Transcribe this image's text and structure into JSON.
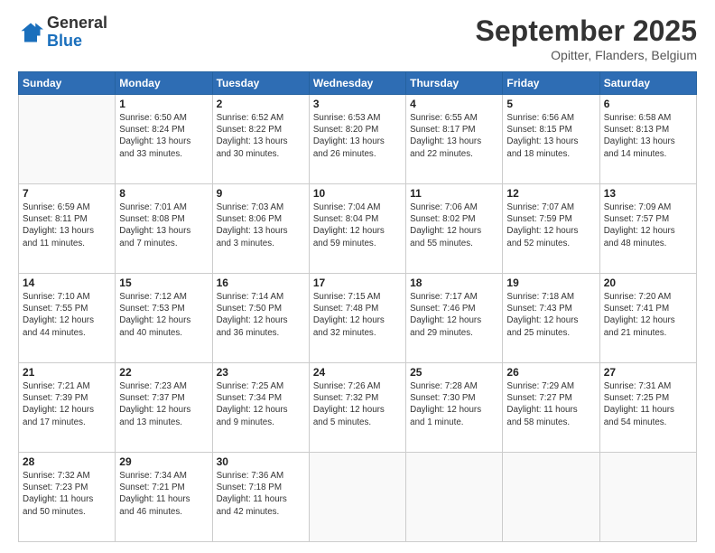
{
  "logo": {
    "general": "General",
    "blue": "Blue"
  },
  "title": "September 2025",
  "location": "Opitter, Flanders, Belgium",
  "days_header": [
    "Sunday",
    "Monday",
    "Tuesday",
    "Wednesday",
    "Thursday",
    "Friday",
    "Saturday"
  ],
  "weeks": [
    [
      {
        "day": "",
        "info": ""
      },
      {
        "day": "1",
        "info": "Sunrise: 6:50 AM\nSunset: 8:24 PM\nDaylight: 13 hours\nand 33 minutes."
      },
      {
        "day": "2",
        "info": "Sunrise: 6:52 AM\nSunset: 8:22 PM\nDaylight: 13 hours\nand 30 minutes."
      },
      {
        "day": "3",
        "info": "Sunrise: 6:53 AM\nSunset: 8:20 PM\nDaylight: 13 hours\nand 26 minutes."
      },
      {
        "day": "4",
        "info": "Sunrise: 6:55 AM\nSunset: 8:17 PM\nDaylight: 13 hours\nand 22 minutes."
      },
      {
        "day": "5",
        "info": "Sunrise: 6:56 AM\nSunset: 8:15 PM\nDaylight: 13 hours\nand 18 minutes."
      },
      {
        "day": "6",
        "info": "Sunrise: 6:58 AM\nSunset: 8:13 PM\nDaylight: 13 hours\nand 14 minutes."
      }
    ],
    [
      {
        "day": "7",
        "info": "Sunrise: 6:59 AM\nSunset: 8:11 PM\nDaylight: 13 hours\nand 11 minutes."
      },
      {
        "day": "8",
        "info": "Sunrise: 7:01 AM\nSunset: 8:08 PM\nDaylight: 13 hours\nand 7 minutes."
      },
      {
        "day": "9",
        "info": "Sunrise: 7:03 AM\nSunset: 8:06 PM\nDaylight: 13 hours\nand 3 minutes."
      },
      {
        "day": "10",
        "info": "Sunrise: 7:04 AM\nSunset: 8:04 PM\nDaylight: 12 hours\nand 59 minutes."
      },
      {
        "day": "11",
        "info": "Sunrise: 7:06 AM\nSunset: 8:02 PM\nDaylight: 12 hours\nand 55 minutes."
      },
      {
        "day": "12",
        "info": "Sunrise: 7:07 AM\nSunset: 7:59 PM\nDaylight: 12 hours\nand 52 minutes."
      },
      {
        "day": "13",
        "info": "Sunrise: 7:09 AM\nSunset: 7:57 PM\nDaylight: 12 hours\nand 48 minutes."
      }
    ],
    [
      {
        "day": "14",
        "info": "Sunrise: 7:10 AM\nSunset: 7:55 PM\nDaylight: 12 hours\nand 44 minutes."
      },
      {
        "day": "15",
        "info": "Sunrise: 7:12 AM\nSunset: 7:53 PM\nDaylight: 12 hours\nand 40 minutes."
      },
      {
        "day": "16",
        "info": "Sunrise: 7:14 AM\nSunset: 7:50 PM\nDaylight: 12 hours\nand 36 minutes."
      },
      {
        "day": "17",
        "info": "Sunrise: 7:15 AM\nSunset: 7:48 PM\nDaylight: 12 hours\nand 32 minutes."
      },
      {
        "day": "18",
        "info": "Sunrise: 7:17 AM\nSunset: 7:46 PM\nDaylight: 12 hours\nand 29 minutes."
      },
      {
        "day": "19",
        "info": "Sunrise: 7:18 AM\nSunset: 7:43 PM\nDaylight: 12 hours\nand 25 minutes."
      },
      {
        "day": "20",
        "info": "Sunrise: 7:20 AM\nSunset: 7:41 PM\nDaylight: 12 hours\nand 21 minutes."
      }
    ],
    [
      {
        "day": "21",
        "info": "Sunrise: 7:21 AM\nSunset: 7:39 PM\nDaylight: 12 hours\nand 17 minutes."
      },
      {
        "day": "22",
        "info": "Sunrise: 7:23 AM\nSunset: 7:37 PM\nDaylight: 12 hours\nand 13 minutes."
      },
      {
        "day": "23",
        "info": "Sunrise: 7:25 AM\nSunset: 7:34 PM\nDaylight: 12 hours\nand 9 minutes."
      },
      {
        "day": "24",
        "info": "Sunrise: 7:26 AM\nSunset: 7:32 PM\nDaylight: 12 hours\nand 5 minutes."
      },
      {
        "day": "25",
        "info": "Sunrise: 7:28 AM\nSunset: 7:30 PM\nDaylight: 12 hours\nand 1 minute."
      },
      {
        "day": "26",
        "info": "Sunrise: 7:29 AM\nSunset: 7:27 PM\nDaylight: 11 hours\nand 58 minutes."
      },
      {
        "day": "27",
        "info": "Sunrise: 7:31 AM\nSunset: 7:25 PM\nDaylight: 11 hours\nand 54 minutes."
      }
    ],
    [
      {
        "day": "28",
        "info": "Sunrise: 7:32 AM\nSunset: 7:23 PM\nDaylight: 11 hours\nand 50 minutes."
      },
      {
        "day": "29",
        "info": "Sunrise: 7:34 AM\nSunset: 7:21 PM\nDaylight: 11 hours\nand 46 minutes."
      },
      {
        "day": "30",
        "info": "Sunrise: 7:36 AM\nSunset: 7:18 PM\nDaylight: 11 hours\nand 42 minutes."
      },
      {
        "day": "",
        "info": ""
      },
      {
        "day": "",
        "info": ""
      },
      {
        "day": "",
        "info": ""
      },
      {
        "day": "",
        "info": ""
      }
    ]
  ]
}
